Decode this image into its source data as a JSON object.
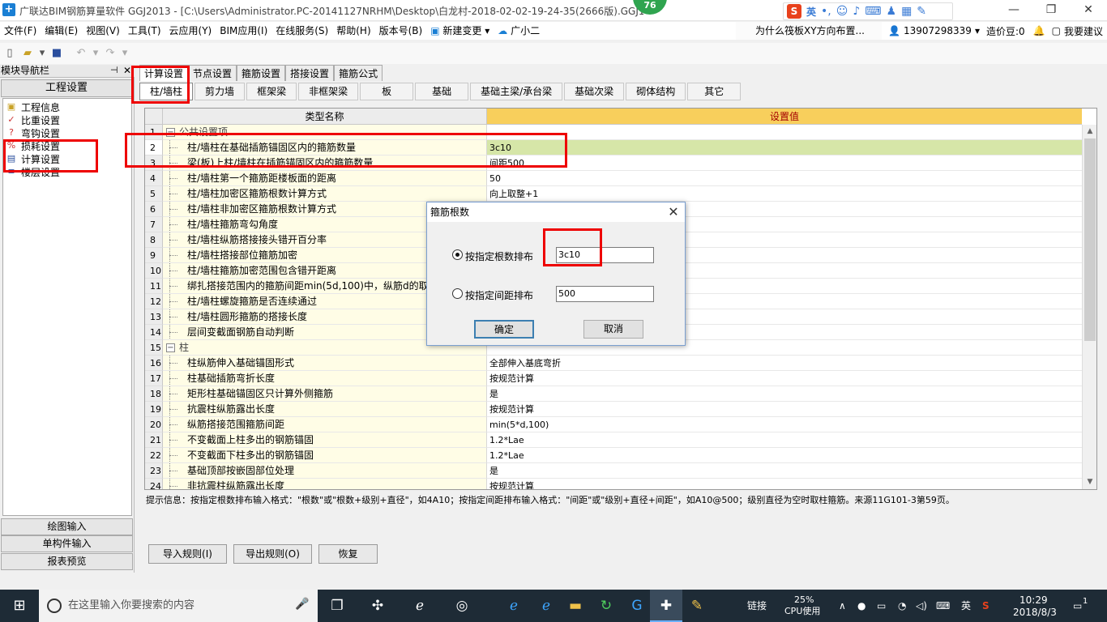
{
  "window": {
    "title": "广联达BIM钢筋算量软件 GGJ2013 - [C:\\Users\\Administrator.PC-20141127NRHM\\Desktop\\白龙村-2018-02-02-19-24-35(2666版).GGJ12",
    "badge": "76",
    "ime": {
      "lang": "英"
    }
  },
  "menu": [
    "文件(F)",
    "编辑(E)",
    "视图(V)",
    "工具(T)",
    "云应用(Y)",
    "BIM应用(I)",
    "在线服务(S)",
    "帮助(H)",
    "版本号(B)",
    "新建变更",
    "广小二"
  ],
  "ad_text": "为什么筏板XY方向布置...",
  "user": {
    "phone": "13907298339",
    "beans": "造价豆:0",
    "suggest": "我要建议"
  },
  "nav": {
    "header": "模块导航栏",
    "section": "工程设置",
    "items": [
      "工程信息",
      "比重设置",
      "弯钩设置",
      "损耗设置",
      "计算设置",
      "楼层设置"
    ],
    "bottom": [
      "绘图输入",
      "单构件输入",
      "报表预览"
    ]
  },
  "top_tabs": [
    "计算设置",
    "节点设置",
    "箍筋设置",
    "搭接设置",
    "箍筋公式"
  ],
  "sub_tabs": [
    "柱/墙柱",
    "剪力墙",
    "框架梁",
    "非框架梁",
    "板",
    "基础",
    "基础主梁/承台梁",
    "基础次梁",
    "砌体结构",
    "其它"
  ],
  "grid": {
    "col_name": "类型名称",
    "col_value": "设置值",
    "rows": [
      {
        "num": "1",
        "name": "公共设置项",
        "value": "",
        "group": true,
        "sign": "−"
      },
      {
        "num": "2",
        "name": "柱/墙柱在基础插筋锚固区内的箍筋数量",
        "value": "3c10"
      },
      {
        "num": "3",
        "name": "梁(板)上柱/墙柱在插筋锚固区内的箍筋数量",
        "value": "间距500"
      },
      {
        "num": "4",
        "name": "柱/墙柱第一个箍筋距楼板面的距离",
        "value": "50"
      },
      {
        "num": "5",
        "name": "柱/墙柱加密区箍筋根数计算方式",
        "value": "向上取整+1"
      },
      {
        "num": "6",
        "name": "柱/墙柱非加密区箍筋根数计算方式",
        "value": ""
      },
      {
        "num": "7",
        "name": "柱/墙柱箍筋弯勾角度",
        "value": ""
      },
      {
        "num": "8",
        "name": "柱/墙柱纵筋搭接接头错开百分率",
        "value": ""
      },
      {
        "num": "9",
        "name": "柱/墙柱搭接部位箍筋加密",
        "value": ""
      },
      {
        "num": "10",
        "name": "柱/墙柱箍筋加密范围包含错开距离",
        "value": ""
      },
      {
        "num": "11",
        "name": "绑扎搭接范围内的箍筋间距min(5d,100)中，纵筋d的取值",
        "value": ""
      },
      {
        "num": "12",
        "name": "柱/墙柱螺旋箍筋是否连续通过",
        "value": ""
      },
      {
        "num": "13",
        "name": "柱/墙柱圆形箍筋的搭接长度",
        "value": ""
      },
      {
        "num": "14",
        "name": "层间变截面钢筋自动判断",
        "value": ""
      },
      {
        "num": "15",
        "name": "柱",
        "value": "",
        "group": true,
        "sign": "−"
      },
      {
        "num": "16",
        "name": "柱纵筋伸入基础锚固形式",
        "value": "全部伸入基底弯折"
      },
      {
        "num": "17",
        "name": "柱基础插筋弯折长度",
        "value": "按规范计算"
      },
      {
        "num": "18",
        "name": "矩形柱基础锚固区只计算外侧箍筋",
        "value": "是"
      },
      {
        "num": "19",
        "name": "抗震柱纵筋露出长度",
        "value": "按规范计算"
      },
      {
        "num": "20",
        "name": "纵筋搭接范围箍筋间距",
        "value": "min(5*d,100)"
      },
      {
        "num": "21",
        "name": "不变截面上柱多出的钢筋锚固",
        "value": "1.2*Lae"
      },
      {
        "num": "22",
        "name": "不变截面下柱多出的钢筋锚固",
        "value": "1.2*Lae"
      },
      {
        "num": "23",
        "name": "基础顶部按嵌固部位处理",
        "value": "是"
      },
      {
        "num": "24",
        "name": "非抗震柱纵筋露出长度",
        "value": "按规范计算"
      }
    ]
  },
  "hint": "提示信息：按指定根数排布输入格式：\"根数\"或\"根数+级别+直径\"，如4A10；按指定间距排布输入格式：\"间距\"或\"级别+直径+间距\"，如A10@500；级别直径为空时取柱箍筋。来源11G101-3第59页。",
  "buttons": {
    "import": "导入规则(I)",
    "export": "导出规则(O)",
    "restore": "恢复"
  },
  "dialog": {
    "title": "箍筋根数",
    "opt_count": "按指定根数排布",
    "count_value": "3c10",
    "opt_spacing": "按指定间距排布",
    "spacing_value": "500",
    "ok": "确定",
    "cancel": "取消"
  },
  "taskbar": {
    "search_placeholder": "在这里输入你要搜索的内容",
    "link": "链接",
    "cpu_pct": "25%",
    "cpu_label": "CPU使用",
    "ime": "英",
    "time": "10:29",
    "date": "2018/8/3",
    "notif": "1"
  }
}
